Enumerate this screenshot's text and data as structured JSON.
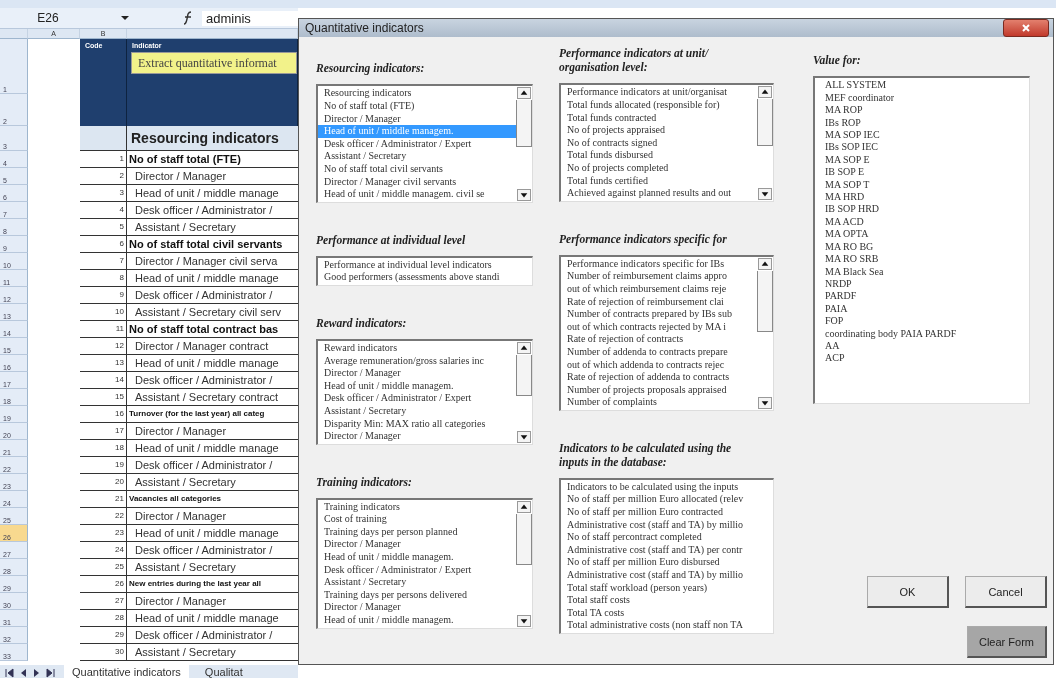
{
  "sheet": {
    "name_box": "E26",
    "formula": "adminis",
    "column_headers": [
      "A",
      "B"
    ],
    "row_headers": [
      {
        "label": "1",
        "selected": false
      },
      {
        "label": "2",
        "selected": false
      },
      {
        "label": "3",
        "selected": false
      },
      {
        "label": "4",
        "selected": false
      },
      {
        "label": "5",
        "selected": false
      },
      {
        "label": "6",
        "selected": false
      },
      {
        "label": "7",
        "selected": false
      },
      {
        "label": "8",
        "selected": false
      },
      {
        "label": "9",
        "selected": false
      },
      {
        "label": "10",
        "selected": false
      },
      {
        "label": "11",
        "selected": false
      },
      {
        "label": "12",
        "selected": false
      },
      {
        "label": "13",
        "selected": false
      },
      {
        "label": "14",
        "selected": false
      },
      {
        "label": "15",
        "selected": false
      },
      {
        "label": "16",
        "selected": false
      },
      {
        "label": "17",
        "selected": false
      },
      {
        "label": "18",
        "selected": false
      },
      {
        "label": "19",
        "selected": false
      },
      {
        "label": "20",
        "selected": false
      },
      {
        "label": "21",
        "selected": false
      },
      {
        "label": "22",
        "selected": false
      },
      {
        "label": "23",
        "selected": false
      },
      {
        "label": "24",
        "selected": false
      },
      {
        "label": "25",
        "selected": false
      },
      {
        "label": "26",
        "selected": true
      },
      {
        "label": "27",
        "selected": false
      },
      {
        "label": "28",
        "selected": false
      },
      {
        "label": "29",
        "selected": false
      },
      {
        "label": "30",
        "selected": false
      },
      {
        "label": "31",
        "selected": false
      },
      {
        "label": "32",
        "selected": false
      },
      {
        "label": "33",
        "selected": false
      }
    ],
    "header": {
      "code": "Code",
      "indicator": "Indicator",
      "note": "Extract quantitative informat"
    },
    "section_title": "Resourcing indicators",
    "items": [
      {
        "code": "1",
        "text": "No of staff total (FTE)",
        "kind": "heading"
      },
      {
        "code": "2",
        "text": "Director / Manager",
        "kind": "item"
      },
      {
        "code": "3",
        "text": "Head of unit / middle manage",
        "kind": "item"
      },
      {
        "code": "4",
        "text": "Desk officer / Administrator /",
        "kind": "item"
      },
      {
        "code": "5",
        "text": "Assistant / Secretary",
        "kind": "item"
      },
      {
        "code": "6",
        "text": "No of staff total civil servants",
        "kind": "heading"
      },
      {
        "code": "7",
        "text": "Director / Manager civil serva",
        "kind": "item"
      },
      {
        "code": "8",
        "text": "Head of unit / middle manage",
        "kind": "item"
      },
      {
        "code": "9",
        "text": "Desk officer / Administrator /",
        "kind": "item"
      },
      {
        "code": "10",
        "text": "Assistant / Secretary civil serv",
        "kind": "item"
      },
      {
        "code": "11",
        "text": "No of staff total contract bas",
        "kind": "heading"
      },
      {
        "code": "12",
        "text": "Director / Manager  contract",
        "kind": "item"
      },
      {
        "code": "13",
        "text": "Head of unit / middle manage",
        "kind": "item"
      },
      {
        "code": "14",
        "text": "Desk officer / Administrator /",
        "kind": "item"
      },
      {
        "code": "15",
        "text": "Assistant / Secretary contract",
        "kind": "item"
      },
      {
        "code": "16",
        "text": "Turnover (for the last year) all categ",
        "kind": "subheading"
      },
      {
        "code": "17",
        "text": "Director / Manager",
        "kind": "item"
      },
      {
        "code": "18",
        "text": "Head of unit / middle manage",
        "kind": "item"
      },
      {
        "code": "19",
        "text": "Desk officer / Administrator /",
        "kind": "item"
      },
      {
        "code": "20",
        "text": "Assistant / Secretary",
        "kind": "item"
      },
      {
        "code": "21",
        "text": "Vacancies all categories",
        "kind": "subheading"
      },
      {
        "code": "22",
        "text": "Director / Manager",
        "kind": "item"
      },
      {
        "code": "23",
        "text": "Head of unit / middle manage",
        "kind": "item"
      },
      {
        "code": "24",
        "text": "Desk officer / Administrator /",
        "kind": "item"
      },
      {
        "code": "25",
        "text": "Assistant / Secretary",
        "kind": "item"
      },
      {
        "code": "26",
        "text": "New entries during the last year all",
        "kind": "subheading"
      },
      {
        "code": "27",
        "text": "Director / Manager",
        "kind": "item"
      },
      {
        "code": "28",
        "text": "Head of unit / middle manage",
        "kind": "item"
      },
      {
        "code": "29",
        "text": "Desk officer / Administrator /",
        "kind": "item"
      },
      {
        "code": "30",
        "text": "Assistant / Secretary",
        "kind": "item"
      }
    ],
    "tabs": [
      {
        "label": "Quantitative indicators",
        "selected": true
      },
      {
        "label": "Qualitat",
        "selected": false
      }
    ]
  },
  "dialog": {
    "title": "Quantitative indicators",
    "columns": [
      {
        "sections": [
          {
            "heading": "Resourcing indicators:",
            "scrollbar": true,
            "items": [
              {
                "label": "Resourcing indicators",
                "selected": false
              },
              {
                "label": "No of staff total (FTE)",
                "selected": false
              },
              {
                "label": "Director / Manager",
                "selected": false
              },
              {
                "label": "Head of unit / middle managem.",
                "selected": true
              },
              {
                "label": "Desk officer / Administrator / Expert",
                "selected": false
              },
              {
                "label": "Assistant / Secretary",
                "selected": false
              },
              {
                "label": "No of staff total civil servants",
                "selected": false
              },
              {
                "label": "Director / Manager civil servants",
                "selected": false
              },
              {
                "label": "Head of unit / middle managem. civil se",
                "selected": false
              }
            ]
          },
          {
            "heading": "Performance at individual level",
            "scrollbar": false,
            "items": [
              {
                "label": "Performance at individual level indicators",
                "selected": false
              },
              {
                "label": "Good performers (assessments above standi",
                "selected": false
              }
            ]
          },
          {
            "heading": "Reward indicators:",
            "scrollbar": true,
            "items": [
              {
                "label": "Reward indicators",
                "selected": false
              },
              {
                "label": "Average remuneration/gross salaries inc",
                "selected": false
              },
              {
                "label": "Director / Manager",
                "selected": false
              },
              {
                "label": "Head of unit / middle managem.",
                "selected": false
              },
              {
                "label": "Desk officer / Administrator / Expert",
                "selected": false
              },
              {
                "label": "Assistant / Secretary",
                "selected": false
              },
              {
                "label": "Disparity Min: MAX ratio all categories",
                "selected": false
              },
              {
                "label": "Director / Manager",
                "selected": false
              }
            ]
          },
          {
            "heading": "Training indicators:",
            "scrollbar": true,
            "items": [
              {
                "label": "Training indicators",
                "selected": false
              },
              {
                "label": "Cost of training",
                "selected": false
              },
              {
                "label": "Training days per person planned",
                "selected": false
              },
              {
                "label": "Director / Manager",
                "selected": false
              },
              {
                "label": "Head of unit / middle managem.",
                "selected": false
              },
              {
                "label": "Desk officer / Administrator / Expert",
                "selected": false
              },
              {
                "label": "Assistant / Secretary",
                "selected": false
              },
              {
                "label": "Training days per persons delivered",
                "selected": false
              },
              {
                "label": "Director / Manager",
                "selected": false
              },
              {
                "label": "Head of unit / middle managem.",
                "selected": false
              }
            ]
          }
        ]
      },
      {
        "sections": [
          {
            "heading": "Performance indicators at unit/ organisation level:",
            "scrollbar": true,
            "items": [
              {
                "label": "Performance indicators at unit/organisat",
                "selected": false
              },
              {
                "label": "Total funds allocated (responsible for)",
                "selected": false
              },
              {
                "label": "Total funds contracted",
                "selected": false
              },
              {
                "label": "No of projects appraised",
                "selected": false
              },
              {
                "label": "No of contracts signed",
                "selected": false
              },
              {
                "label": "Total funds disbursed",
                "selected": false
              },
              {
                "label": "No of projects completed",
                "selected": false
              },
              {
                "label": "Total funds certified",
                "selected": false
              },
              {
                "label": "Achieved against planned results and out",
                "selected": false
              }
            ]
          },
          {
            "heading": "Performance indicators specific for",
            "scrollbar": true,
            "items": [
              {
                "label": "Performance indicators specific for IBs",
                "selected": false
              },
              {
                "label": "Number of reimbursement claims appro",
                "selected": false
              },
              {
                "label": "out of which reimbursement claims reje",
                "selected": false
              },
              {
                "label": "Rate of rejection of reimbursement clai",
                "selected": false
              },
              {
                "label": "Number of contracts prepared by IBs sub",
                "selected": false
              },
              {
                "label": "out of which contracts rejected by MA i",
                "selected": false
              },
              {
                "label": "Rate of rejection of contracts",
                "selected": false
              },
              {
                "label": "Number of addenda to contracts prepare",
                "selected": false
              },
              {
                "label": "out of which addenda to contracts rejec",
                "selected": false
              },
              {
                "label": "Rate of rejection of addenda to contracts",
                "selected": false
              },
              {
                "label": "Number of projects proposals appraised",
                "selected": false
              },
              {
                "label": "Number of complaints",
                "selected": false
              }
            ]
          },
          {
            "heading": "Indicators to be calculated using the inputs in the database:",
            "scrollbar": false,
            "items": [
              {
                "label": "Indicators to be calculated using the inputs",
                "selected": false
              },
              {
                "label": "No of staff per million Euro allocated (relev",
                "selected": false
              },
              {
                "label": "No of staff per million Euro contracted",
                "selected": false
              },
              {
                "label": "Administrative cost (staff and TA) by millio",
                "selected": false
              },
              {
                "label": "No of staff percontract completed",
                "selected": false
              },
              {
                "label": "Administrative cost (staff and TA) per contr",
                "selected": false
              },
              {
                "label": "No of staff per million Euro disbursed",
                "selected": false
              },
              {
                "label": "Administrative cost (staff and TA) by millio",
                "selected": false
              },
              {
                "label": "Total staff workload (person years)",
                "selected": false
              },
              {
                "label": "Total staff costs",
                "selected": false
              },
              {
                "label": "Total TA costs",
                "selected": false
              },
              {
                "label": "Total administrative costs (non staff non TA",
                "selected": false
              }
            ]
          }
        ]
      }
    ],
    "value_for": {
      "heading": "Value for:",
      "items": [
        {
          "label": "ALL SYSTEM",
          "selected": false
        },
        {
          "label": "MEF coordinator",
          "selected": false
        },
        {
          "label": "MA ROP",
          "selected": false
        },
        {
          "label": "IBs ROP",
          "selected": false
        },
        {
          "label": "MA SOP IEC",
          "selected": false
        },
        {
          "label": "IBs SOP IEC",
          "selected": false
        },
        {
          "label": "MA SOP E",
          "selected": false
        },
        {
          "label": "IB SOP E",
          "selected": false
        },
        {
          "label": "MA SOP T",
          "selected": false
        },
        {
          "label": "MA HRD",
          "selected": false
        },
        {
          "label": "IB SOP HRD",
          "selected": false
        },
        {
          "label": "MA ACD",
          "selected": false
        },
        {
          "label": "MA OPTA",
          "selected": false
        },
        {
          "label": "MA RO BG",
          "selected": false
        },
        {
          "label": "MA RO SRB",
          "selected": false
        },
        {
          "label": "MA Black Sea",
          "selected": false
        },
        {
          "label": "NRDP",
          "selected": false
        },
        {
          "label": "PARDF",
          "selected": false
        },
        {
          "label": "PAIA",
          "selected": false
        },
        {
          "label": "FOP",
          "selected": false
        },
        {
          "label": "coordinating body PAIA PARDF",
          "selected": false
        },
        {
          "label": "AA",
          "selected": false
        },
        {
          "label": "ACP",
          "selected": false
        }
      ]
    },
    "buttons": [
      {
        "label": "OK",
        "kind": "plain"
      },
      {
        "label": "Cancel",
        "kind": "plain"
      },
      {
        "label": "Clear Form",
        "kind": "shaded"
      }
    ]
  }
}
